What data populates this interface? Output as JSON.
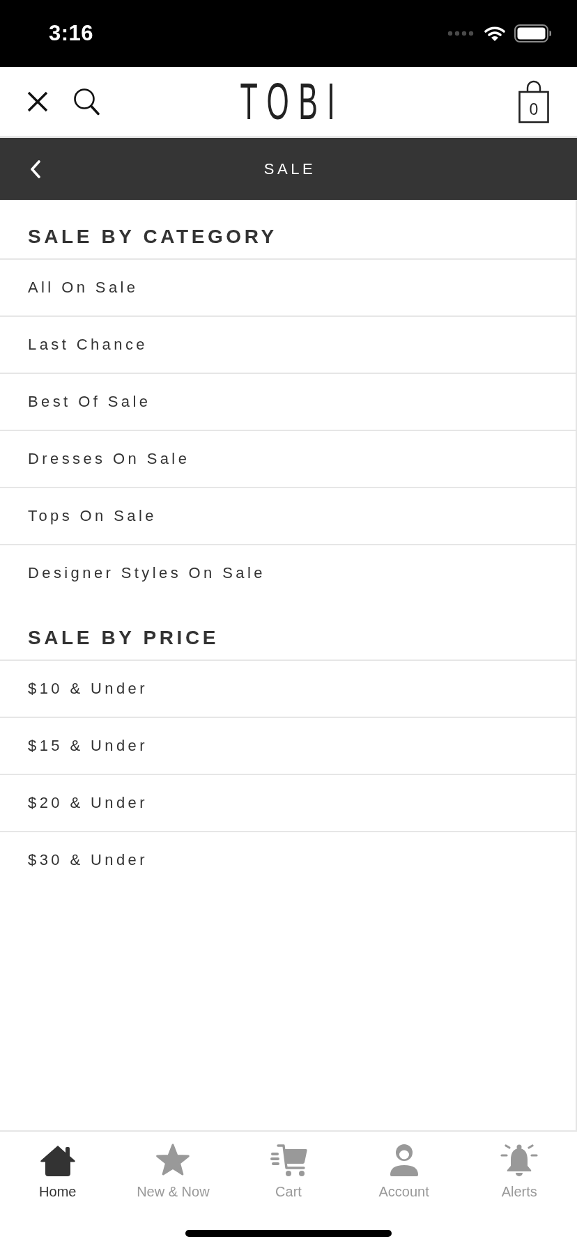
{
  "status_bar": {
    "time": "3:16"
  },
  "header": {
    "logo": "TOBI",
    "cart_count": "0"
  },
  "title_bar": {
    "title": "SALE"
  },
  "sections": [
    {
      "heading": "SALE BY CATEGORY",
      "items": [
        "All On Sale",
        "Last Chance",
        "Best Of Sale",
        "Dresses On Sale",
        "Tops On Sale",
        "Designer Styles On Sale"
      ]
    },
    {
      "heading": "SALE BY PRICE",
      "items": [
        "$10 & Under",
        "$15 & Under",
        "$20 & Under",
        "$30 & Under"
      ]
    }
  ],
  "tab_bar": [
    {
      "kind": "home",
      "label": "Home",
      "selected": true
    },
    {
      "kind": "star",
      "label": "New & Now",
      "selected": false
    },
    {
      "kind": "cart",
      "label": "Cart",
      "selected": false
    },
    {
      "kind": "account",
      "label": "Account",
      "selected": false
    },
    {
      "kind": "alerts",
      "label": "Alerts",
      "selected": false
    }
  ]
}
